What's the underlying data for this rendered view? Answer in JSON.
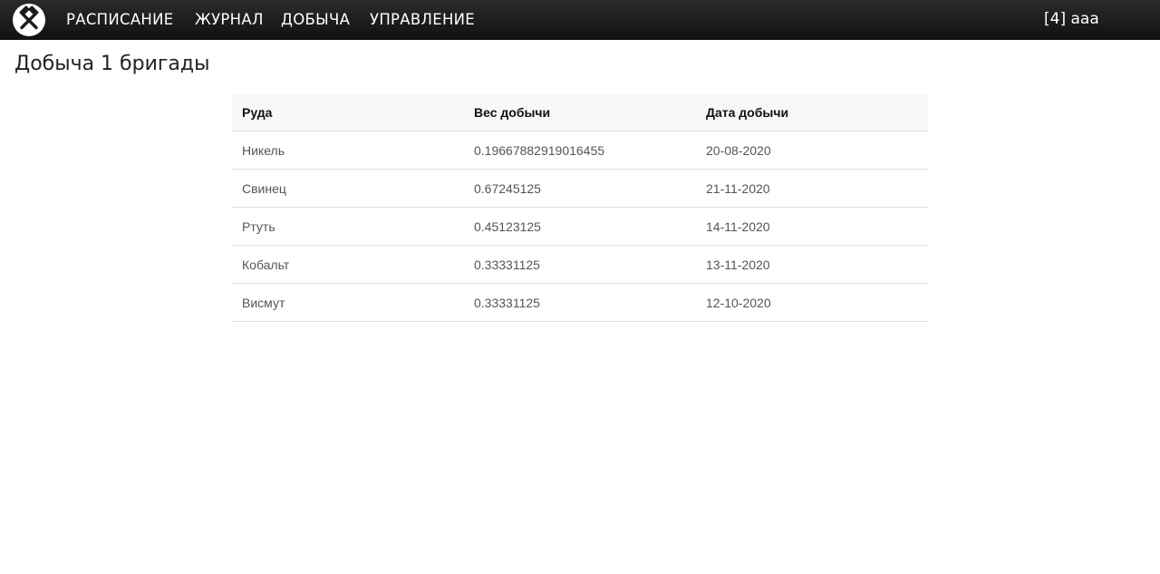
{
  "navbar": {
    "logo_icon": "crossed-hammers-icon",
    "links": [
      {
        "label": "РАСПИСАНИЕ"
      },
      {
        "label": "ЖУРНАЛ"
      },
      {
        "label": "ДОБЫЧА"
      },
      {
        "label": "УПРАВЛЕНИЕ"
      }
    ],
    "user": "[4] aaa",
    "background": "#1a1a1a"
  },
  "page": {
    "title": "Добыча 1 бригады"
  },
  "table": {
    "columns": [
      "Руда",
      "Вес добычи",
      "Дата добычи"
    ],
    "rows": [
      {
        "ore": "Никель",
        "weight": "0.19667882919016455",
        "date": "20-08-2020"
      },
      {
        "ore": "Свинец",
        "weight": "0.67245125",
        "date": "21-11-2020"
      },
      {
        "ore": "Ртуть",
        "weight": "0.45123125",
        "date": "14-11-2020"
      },
      {
        "ore": "Кобальт",
        "weight": "0.33331125",
        "date": "13-11-2020"
      },
      {
        "ore": "Висмут",
        "weight": "0.33331125",
        "date": "12-10-2020"
      }
    ]
  }
}
